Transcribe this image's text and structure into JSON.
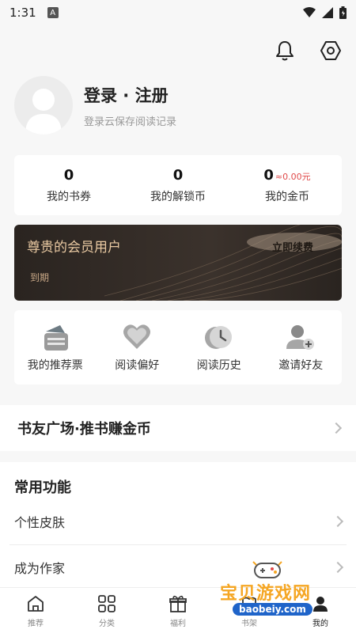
{
  "status_bar": {
    "time": "1:31",
    "badge": "A"
  },
  "profile": {
    "title": "登录 · 注册",
    "subtitle": "登录云保存阅读记录"
  },
  "stats": [
    {
      "value": "0",
      "label": "我的书券"
    },
    {
      "value": "0",
      "label": "我的解锁币"
    },
    {
      "value": "0",
      "approx": "≈0.00元",
      "label": "我的金币"
    }
  ],
  "vip": {
    "title": "尊贵的会员用户",
    "renew": "立即续费",
    "expire": "到期"
  },
  "actions": [
    {
      "label": "我的推荐票",
      "icon": "ticket-icon"
    },
    {
      "label": "阅读偏好",
      "icon": "heart-icon"
    },
    {
      "label": "阅读历史",
      "icon": "clock-icon"
    },
    {
      "label": "邀请好友",
      "icon": "add-friend-icon"
    }
  ],
  "square": {
    "label": "书友广场·推书赚金币"
  },
  "functions": {
    "title": "常用功能",
    "items": [
      {
        "label": "个性皮肤"
      },
      {
        "label": "成为作家"
      }
    ]
  },
  "tabs": [
    {
      "label": "推荐",
      "icon": "home-icon"
    },
    {
      "label": "分类",
      "icon": "grid-icon"
    },
    {
      "label": "福利",
      "icon": "gift-icon"
    },
    {
      "label": "书架",
      "icon": "bookshelf-icon"
    },
    {
      "label": "我的",
      "icon": "profile-icon"
    }
  ],
  "watermark": {
    "text": "宝贝游戏网",
    "url": "baobeiy.com"
  }
}
